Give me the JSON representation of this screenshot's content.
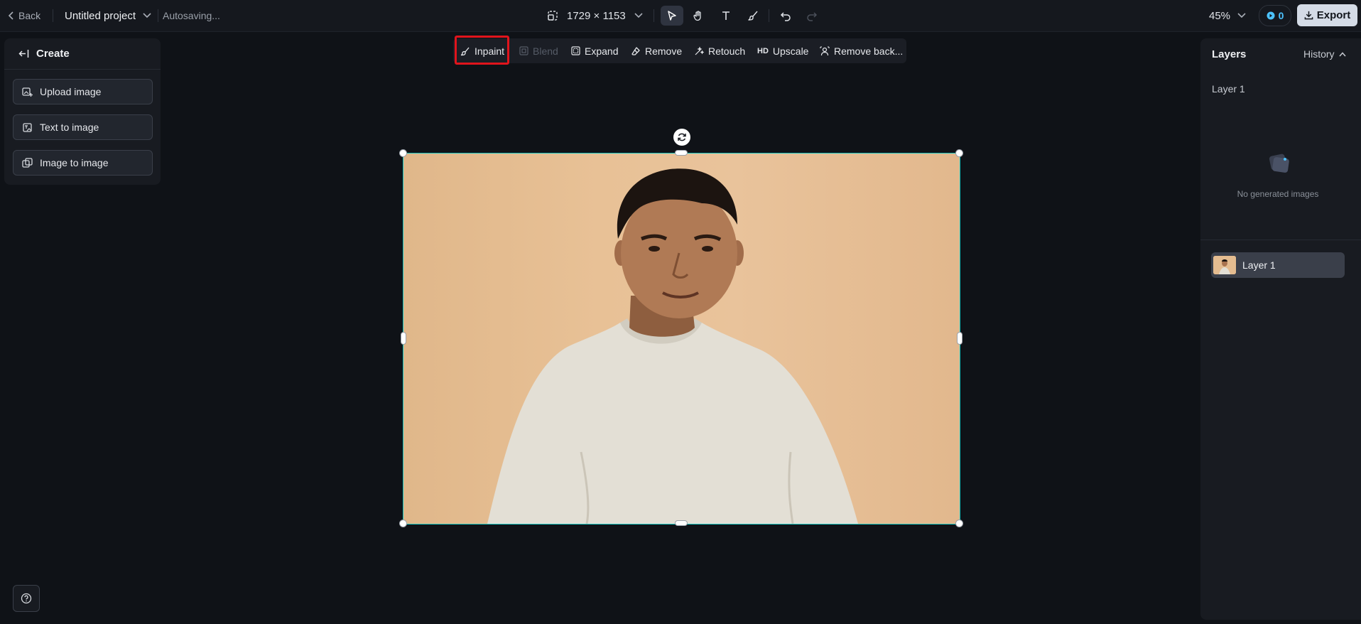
{
  "topbar": {
    "back_label": "Back",
    "project_name": "Untitled project",
    "status": "Autosaving...",
    "dimensions": "1729 × 1153",
    "zoom": "45%",
    "credits": "0",
    "export_label": "Export"
  },
  "tools": [
    "select-icon",
    "hand-icon",
    "text-icon",
    "brush-icon",
    "undo-icon",
    "redo-icon"
  ],
  "left_panel": {
    "header": "Create",
    "buttons": [
      {
        "label": "Upload image",
        "icon": "upload-image-icon"
      },
      {
        "label": "Text to image",
        "icon": "text-to-image-icon"
      },
      {
        "label": "Image to image",
        "icon": "image-to-image-icon"
      }
    ]
  },
  "edit_toolbar": {
    "items": [
      {
        "label": "Inpaint",
        "icon": "inpaint-icon",
        "enabled": true,
        "highlighted": true
      },
      {
        "label": "Blend",
        "icon": "blend-icon",
        "enabled": false
      },
      {
        "label": "Expand",
        "icon": "expand-icon",
        "enabled": true
      },
      {
        "label": "Remove",
        "icon": "eraser-icon",
        "enabled": true
      },
      {
        "label": "Retouch",
        "icon": "retouch-icon",
        "enabled": true
      },
      {
        "label": "Upscale",
        "icon": "hd-icon",
        "icon_text": "HD",
        "enabled": true
      },
      {
        "label": "Remove back...",
        "icon": "remove-background-icon",
        "enabled": true
      }
    ]
  },
  "right_panel": {
    "title": "Layers",
    "history_label": "History",
    "current_layer": "Layer 1",
    "empty_text": "No generated images",
    "layers": [
      {
        "name": "Layer 1"
      }
    ]
  },
  "colors": {
    "background": "#0f1217",
    "selection": "#16c5c0",
    "highlight": "#e0141c",
    "credits": "#4cc3ff",
    "export_bg": "#d4dbe6"
  }
}
